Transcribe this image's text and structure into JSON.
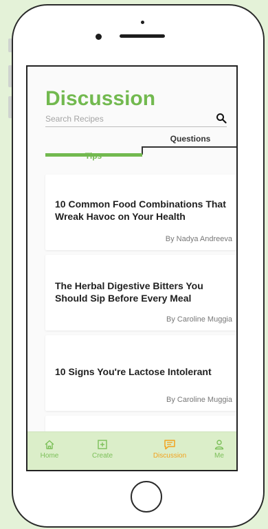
{
  "page": {
    "title": "Discussion",
    "search_placeholder": "Search Recipes"
  },
  "tabs": [
    {
      "label": "Tips",
      "active": true
    },
    {
      "label": "Questions",
      "active": false
    }
  ],
  "articles": [
    {
      "title": "10 Common Food Combinations That Wreak Havoc on Your Health",
      "author": "By Nadya Andreeva"
    },
    {
      "title": "The Herbal Digestive Bitters You Should Sip Before Every Meal",
      "author": "By Caroline Muggia"
    },
    {
      "title": "10 Signs You're Lactose Intolerant",
      "author": "By Caroline Muggia"
    }
  ],
  "nav": [
    {
      "label": "Home",
      "icon": "home-icon",
      "active": false
    },
    {
      "label": "Create",
      "icon": "plus-square-icon",
      "active": false
    },
    {
      "label": "Discussion",
      "icon": "chat-bubble-icon",
      "active": true
    },
    {
      "label": "Me",
      "icon": "person-icon",
      "active": false
    }
  ],
  "colors": {
    "accent": "#72b94f",
    "active_nav": "#f2a21e",
    "nav_background": "#dbeec9",
    "page_background": "#e4f2d8"
  }
}
